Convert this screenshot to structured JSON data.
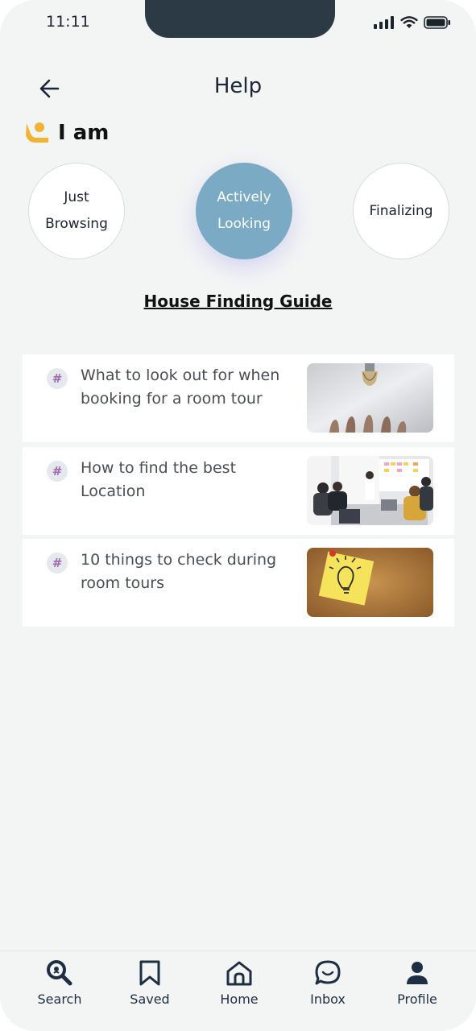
{
  "status_bar": {
    "time": "11:11"
  },
  "header": {
    "title": "Help"
  },
  "iam_label": "I am",
  "stages": [
    {
      "line1": "Just",
      "line2": "Browsing",
      "active": false
    },
    {
      "line1": "Actively",
      "line2": "Looking",
      "active": true
    },
    {
      "line1": "Finalizing",
      "line2": "",
      "active": false
    }
  ],
  "guide_title": "House Finding Guide",
  "articles": [
    {
      "title": "What to look out for when booking for a room tour",
      "image": "lightbulb-hand"
    },
    {
      "title": "How to find the best Location",
      "image": "team-meeting"
    },
    {
      "title": "10 things to check during room tours",
      "image": "sticky-note-corkboard"
    }
  ],
  "tabs": [
    {
      "label": "Search",
      "icon": "search-icon"
    },
    {
      "label": "Saved",
      "icon": "bookmark-icon"
    },
    {
      "label": "Home",
      "icon": "home-icon"
    },
    {
      "label": "Inbox",
      "icon": "chat-icon"
    },
    {
      "label": "Profile",
      "icon": "profile-icon"
    }
  ],
  "colors": {
    "accent": "#7aaac4",
    "notch": "#2b3a44",
    "iam_icon": "#f2b233",
    "tab": "#1e2f44"
  }
}
